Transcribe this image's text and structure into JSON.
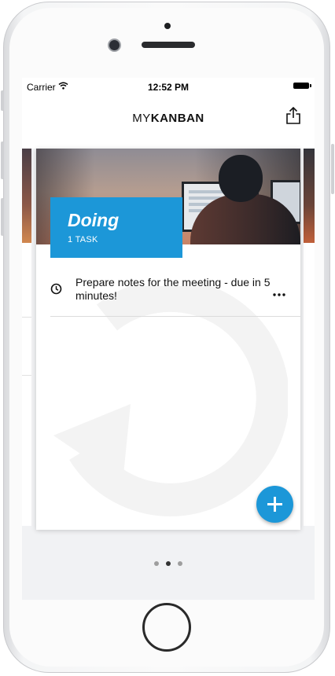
{
  "status_bar": {
    "carrier": "Carrier",
    "time": "12:52 PM",
    "wifi_icon": "wifi-icon",
    "battery_icon": "battery-icon"
  },
  "header": {
    "title_light": "MY",
    "title_bold": "KANBAN",
    "share_icon": "share-icon"
  },
  "board": {
    "list": {
      "title": "Doing",
      "task_count": "1 TASK",
      "header_color": "#1c97d8",
      "tasks": [
        {
          "icon": "clock-icon",
          "text": "Prepare notes for the meeting - due in 5 minutes!",
          "menu_icon": "more-icon"
        }
      ]
    },
    "add_button_icon": "plus-icon",
    "page_indicator": {
      "count": 3,
      "active_index": 1
    }
  },
  "colors": {
    "accent": "#1c97d8",
    "text": "#111111",
    "dot_active": "#333333",
    "dot_inactive": "#9e9e9e"
  }
}
